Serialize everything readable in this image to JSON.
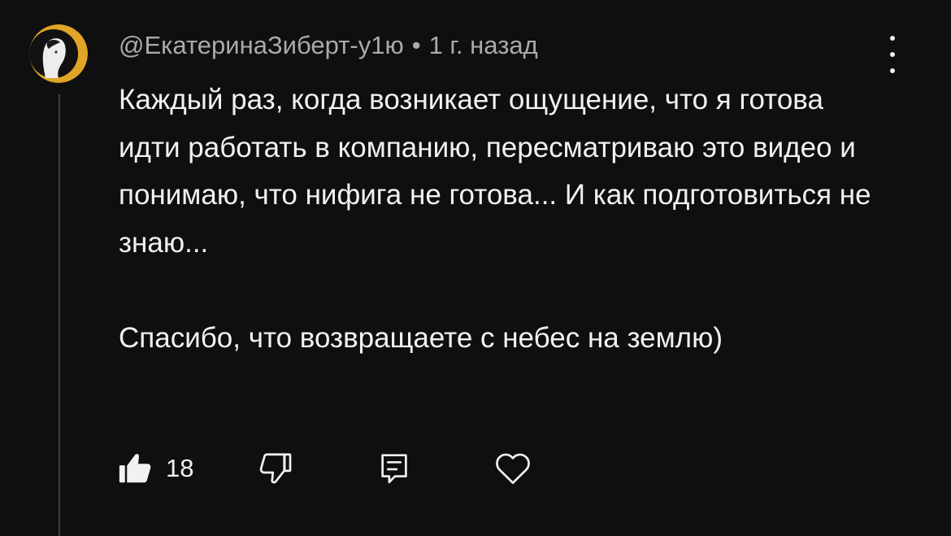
{
  "comment": {
    "author": "@ЕкатеринаЗиберт-у1ю",
    "separator": "•",
    "time": "1 г. назад",
    "paragraphs": [
      "Каждый раз, когда возникает ощущение, что я готова идти работать в компанию, пересматриваю это видео и понимаю, что нифига не готова... И как подготовиться не знаю...",
      "Спасибо, что возвращаете с небес на землю)"
    ],
    "likes": "18"
  },
  "icons": {
    "menu": "more-vert-icon",
    "like": "thumb-up-filled-icon",
    "dislike": "thumb-down-outline-icon",
    "reply": "reply-comment-icon",
    "heart": "heart-outline-icon"
  },
  "colors": {
    "background": "#0f0f0f",
    "text": "#f1f1f1",
    "meta": "#aaaaaa",
    "avatar_ring": "#e0a526"
  }
}
